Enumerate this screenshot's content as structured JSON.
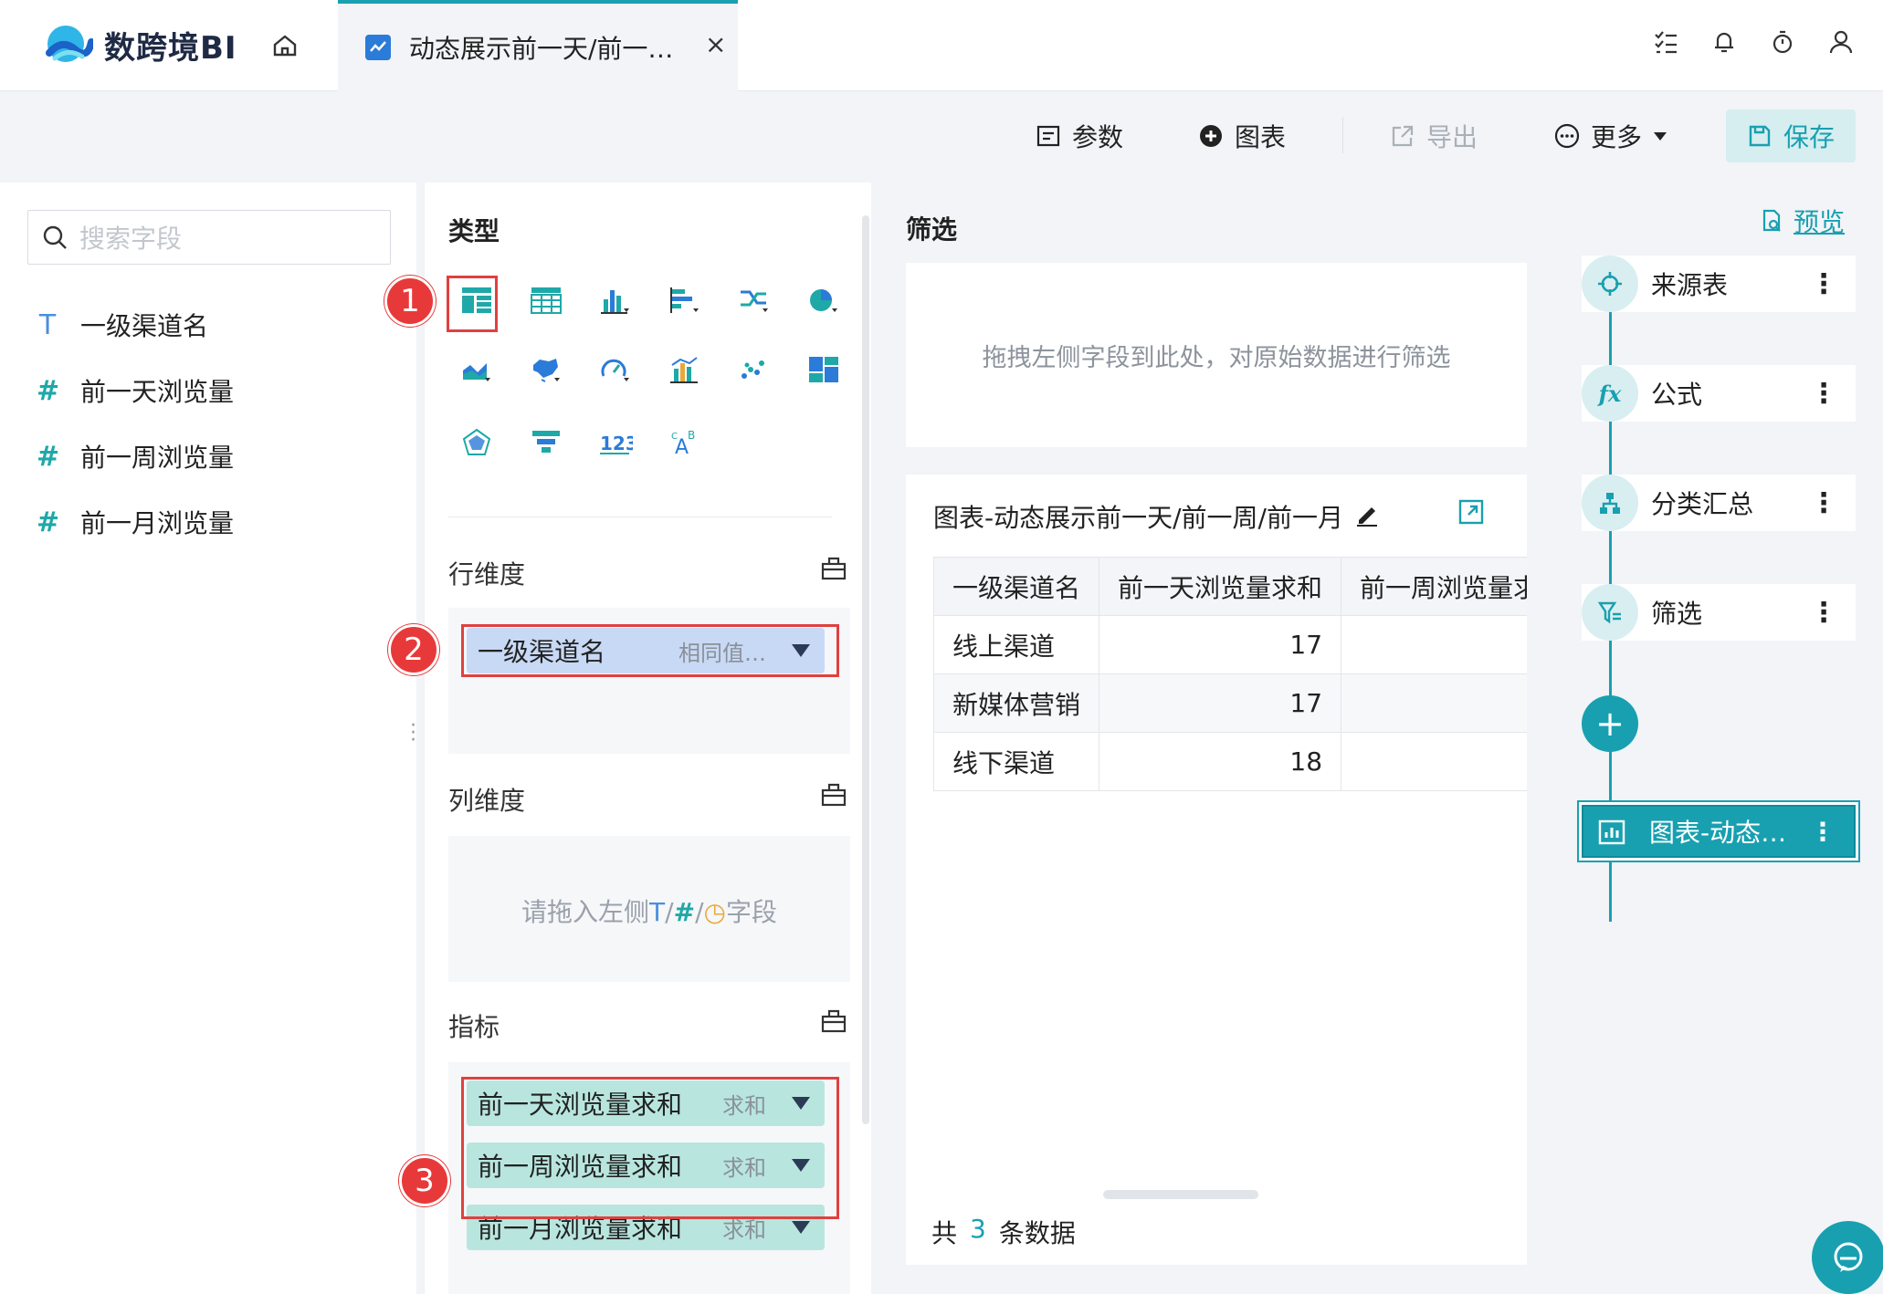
{
  "app": {
    "logo_text": "数跨境BI"
  },
  "tab": {
    "title": "动态展示前一天/前一…",
    "close": "×"
  },
  "toolbar": {
    "params": "参数",
    "chart": "图表",
    "export": "导出",
    "more": "更多",
    "save": "保存"
  },
  "fields": {
    "search_placeholder": "搜索字段",
    "items": [
      {
        "type": "T",
        "label": "一级渠道名"
      },
      {
        "type": "#",
        "label": "前一天浏览量"
      },
      {
        "type": "#",
        "label": "前一周浏览量"
      },
      {
        "type": "#",
        "label": "前一月浏览量"
      }
    ]
  },
  "config": {
    "type_title": "类型",
    "row_dim_title": "行维度",
    "col_dim_title": "列维度",
    "measure_title": "指标",
    "row_dim_pill": {
      "label": "一级渠道名",
      "sub": "相同值…"
    },
    "col_placeholder_prefix": "请拖入左侧",
    "col_placeholder_t": "T",
    "col_placeholder_num": "#",
    "col_placeholder_suffix": "字段",
    "measures": [
      {
        "label": "前一天浏览量求和",
        "sub": "求和"
      },
      {
        "label": "前一周浏览量求和",
        "sub": "求和"
      },
      {
        "label": "前一月浏览量求和",
        "sub": "求和"
      }
    ],
    "badges": [
      "1",
      "2",
      "3"
    ]
  },
  "filter": {
    "title": "筛选",
    "placeholder": "拖拽左侧字段到此处，对原始数据进行筛选"
  },
  "chart": {
    "title": "图表-动态展示前一天/前一周/前一月",
    "columns": [
      "一级渠道名",
      "前一天浏览量求和",
      "前一周浏览量求和"
    ],
    "rows": [
      [
        "线上渠道",
        "17"
      ],
      [
        "新媒体营销",
        "17"
      ],
      [
        "线下渠道",
        "18"
      ]
    ],
    "footer_prefix": "共",
    "footer_count": "3",
    "footer_suffix": "条数据"
  },
  "flow": {
    "preview": "预览",
    "nodes": [
      {
        "label": "来源表",
        "icon": "crosshair-icon"
      },
      {
        "label": "公式",
        "icon": "fx-icon"
      },
      {
        "label": "分类汇总",
        "icon": "hierarchy-icon"
      },
      {
        "label": "筛选",
        "icon": "filter-icon"
      }
    ],
    "add": "+",
    "chart_node": "图表-动态…",
    "menu": "⋮"
  },
  "colors": {
    "accent": "#18a0b0",
    "highlight": "#e04040",
    "dimension_pill": "#c8d9f5",
    "measure_pill": "#b8e6df"
  }
}
